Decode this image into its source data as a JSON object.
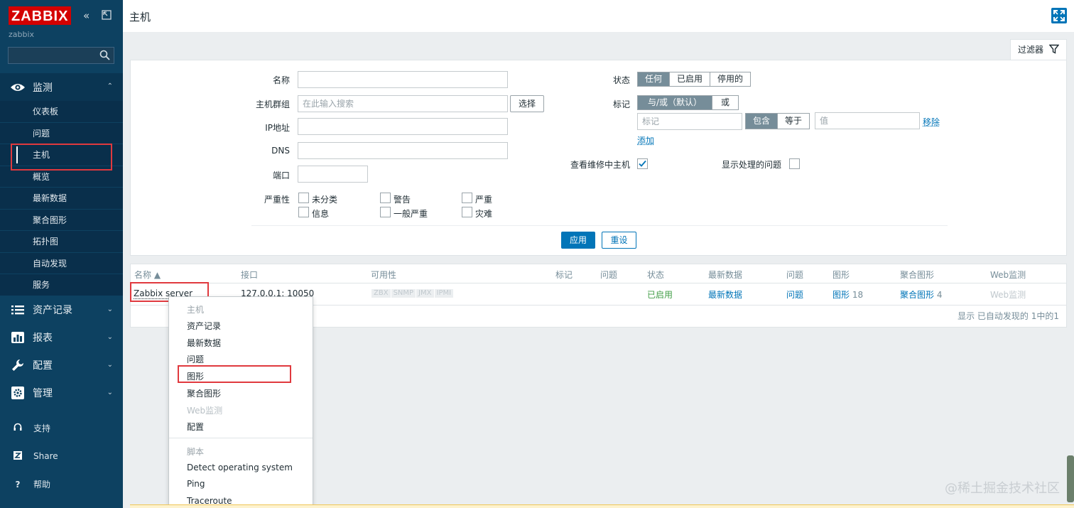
{
  "sidebar": {
    "logo": "ZABBIX",
    "server_name": "zabbix",
    "collapse_glyph": "«",
    "menu": [
      {
        "label": "监测",
        "icon": "eye-icon"
      },
      {
        "label": "资产记录",
        "icon": "list-icon"
      },
      {
        "label": "报表",
        "icon": "bar-chart-icon"
      },
      {
        "label": "配置",
        "icon": "wrench-icon"
      },
      {
        "label": "管理",
        "icon": "gear-icon"
      }
    ],
    "submenu": [
      "仪表板",
      "问题",
      "主机",
      "概览",
      "最新数据",
      "聚合图形",
      "拓扑图",
      "自动发现",
      "服务"
    ],
    "bottom": [
      {
        "label": "支持",
        "icon": "headset-icon"
      },
      {
        "label": "Share",
        "icon": "share-icon"
      },
      {
        "label": "帮助",
        "icon": "help-icon"
      }
    ]
  },
  "header": {
    "title": "主机"
  },
  "filter": {
    "tab_label": "过滤器",
    "name_label": "名称",
    "hostgroup_label": "主机群组",
    "hostgroup_placeholder": "在此输入搜索",
    "select_button": "选择",
    "ip_label": "IP地址",
    "dns_label": "DNS",
    "port_label": "端口",
    "severity_label": "严重性",
    "severities": [
      "未分类",
      "警告",
      "严重",
      "信息",
      "一般严重",
      "灾难"
    ],
    "status_label": "状态",
    "status_options": [
      "任何",
      "已启用",
      "停用的"
    ],
    "tags_label": "标记",
    "tag_logic": [
      "与/或（默认）",
      "或"
    ],
    "tag_placeholder": "标记",
    "tag_ops": [
      "包含",
      "等于"
    ],
    "value_placeholder": "值",
    "remove_link": "移除",
    "add_link": "添加",
    "maintenance_label": "查看维修中主机",
    "suppressed_label": "显示处理的问题",
    "apply_button": "应用",
    "reset_button": "重设"
  },
  "table": {
    "headers": [
      "名称 ▲",
      "接口",
      "可用性",
      "标记",
      "问题",
      "状态",
      "最新数据",
      "问题",
      "图形",
      "聚合图形",
      "Web监测"
    ],
    "row": {
      "name": "Zabbix server",
      "interface": "127.0.0.1: 10050",
      "availability": [
        "ZBX",
        "SNMP",
        "JMX",
        "IPMI"
      ],
      "status": "已启用",
      "latest": "最新数据",
      "problems": "问题",
      "graphs": "图形",
      "graphs_count": "18",
      "screens": "聚合图形",
      "screens_count": "4",
      "web": "Web监测"
    },
    "footer": "显示 已自动发现的 1中的1"
  },
  "context_menu": {
    "host_header": "主机",
    "items": [
      "资产记录",
      "最新数据",
      "问题",
      "图形",
      "聚合图形",
      "Web监测",
      "配置"
    ],
    "scripts_header": "脚本",
    "scripts": [
      "Detect operating system",
      "Ping",
      "Traceroute"
    ]
  },
  "watermark": "@稀土掘金技术社区",
  "colors": {
    "sidebar": "#0d4161",
    "accent": "#0275b8",
    "logo_red": "#d40000",
    "enabled_green": "#429e47",
    "highlight_red": "#e0393e"
  }
}
